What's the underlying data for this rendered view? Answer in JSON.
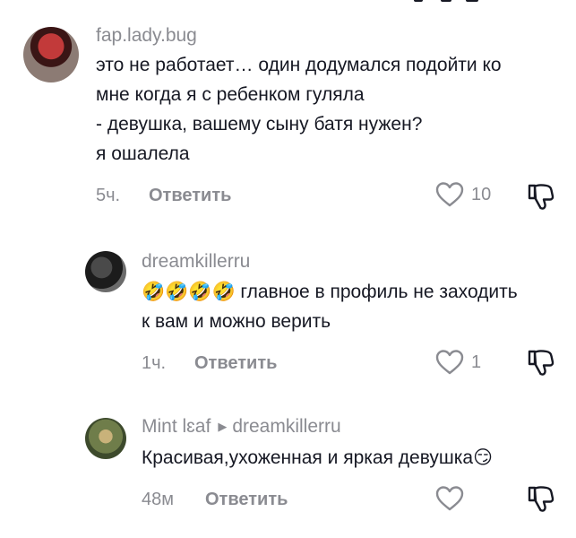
{
  "comments": [
    {
      "username": "fap.lady.bug",
      "lines": [
        "это не работает… один додумался подойти ко",
        "мне когда я с ребенком гуляла",
        "- девушка, вашему сыну батя нужен?",
        "я ошалела"
      ],
      "time": "5ч.",
      "reply_label": "Ответить",
      "likes": "10"
    },
    {
      "username": "dreamkillerru",
      "emoji_prefix": "🤣🤣🤣🤣",
      "lines": [
        " главное в профиль не заходить",
        "к вам и можно верить"
      ],
      "time": "1ч.",
      "reply_label": "Ответить",
      "likes": "1"
    },
    {
      "username": "Mint lɛaf",
      "reply_to": "dreamkillerru",
      "lines": [
        "Красивая,ухоженная и яркая девушка"
      ],
      "emoji_suffix": "😏",
      "time": "48м",
      "reply_label": "Ответить",
      "likes": ""
    }
  ],
  "colors": {
    "text": "#161823",
    "secondary": "#8a8b91"
  },
  "icons": {
    "like": "heart-outline-icon",
    "dislike": "thumbs-down-icon",
    "reply_arrow": "triangle-right-icon"
  }
}
